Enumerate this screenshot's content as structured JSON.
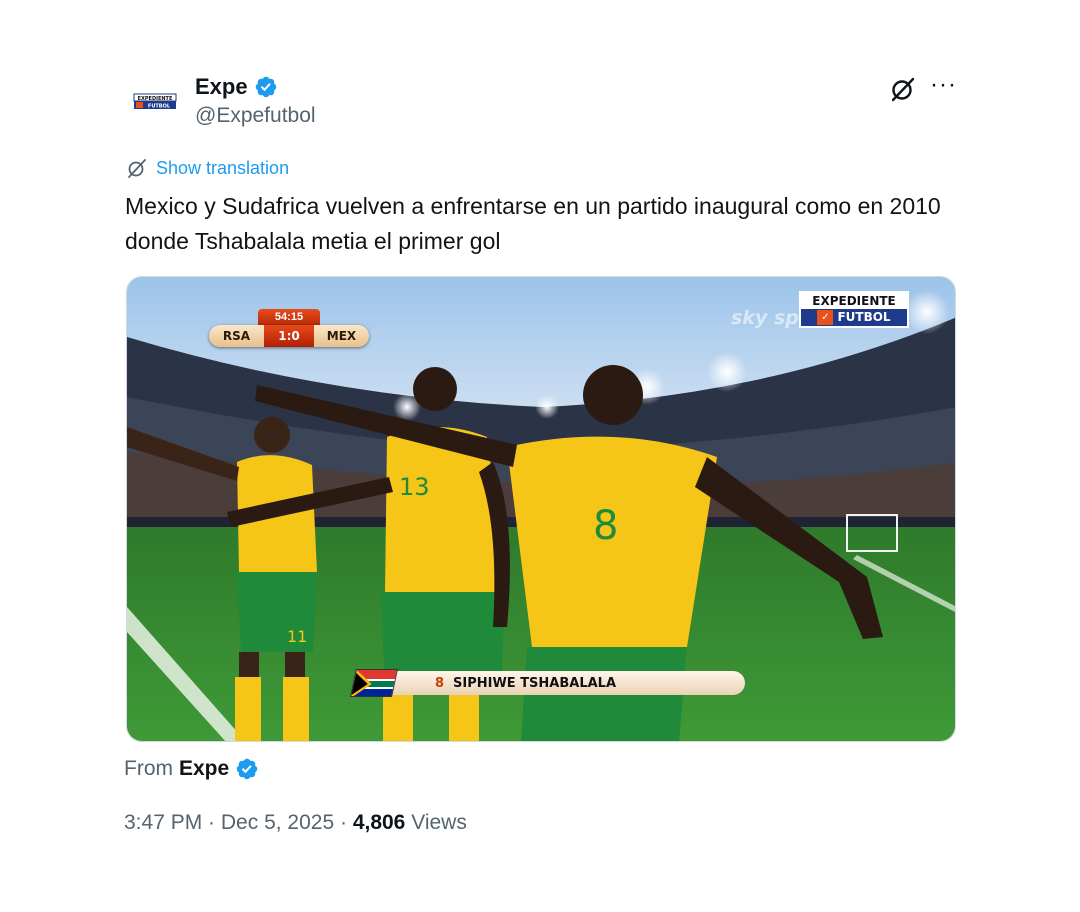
{
  "author": {
    "name": "Expe",
    "handle": "@Expefutbol",
    "avatar_label": "EXPEDIENTE FUTBOL",
    "verified": true
  },
  "actions": {
    "grok_icon": "grok-icon",
    "more_icon": "more-icon",
    "more_label": "···"
  },
  "translation": {
    "label": "Show translation",
    "icon": "translate-icon"
  },
  "tweet": {
    "text": "Mexico y Sudafrica vuelven a enfrentarse en un partido inaugural como en 2010 donde Tshabalala metia el primer gol"
  },
  "media": {
    "scoreboard": {
      "time": "54:15",
      "home": "RSA",
      "score": "1:0",
      "away": "MEX"
    },
    "logo": {
      "top": "EXPEDIENTE",
      "bottom": "FUTBOL"
    },
    "watermark": "sky sp",
    "player_banner": {
      "number": "8",
      "name": "SIPHIWE TSHABALALA"
    },
    "jersey_numbers": [
      "11",
      "13",
      "8"
    ]
  },
  "source": {
    "prefix": "From",
    "name": "Expe"
  },
  "meta": {
    "time": "3:47 PM",
    "sep1": " · ",
    "date": "Dec 5, 2025",
    "sep2": " · ",
    "views_count": "4,806",
    "views_label": " Views"
  },
  "colors": {
    "accent": "#1d9bf0",
    "text": "#0f1419",
    "secondary": "#536471",
    "jersey": "#f5c518",
    "shorts": "#1f8a3a"
  }
}
